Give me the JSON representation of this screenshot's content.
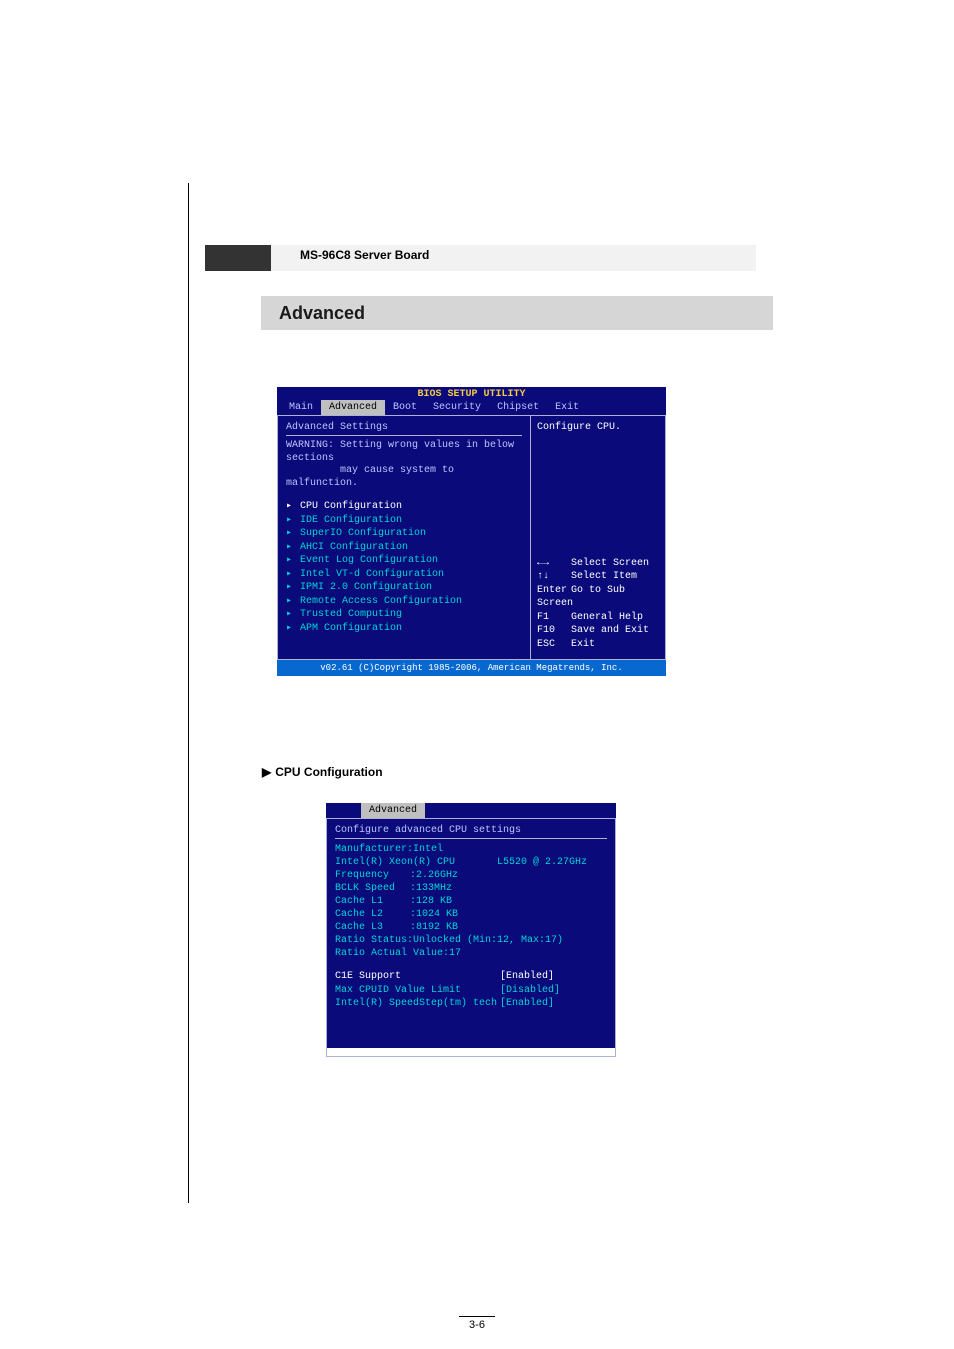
{
  "header": {
    "board_name": "MS-96C8 Server Board"
  },
  "section": {
    "title": "Advanced"
  },
  "bios_main": {
    "title": "BIOS SETUP UTILITY",
    "tabs": [
      "Main",
      "Advanced",
      "Boot",
      "Security",
      "Chipset",
      "Exit"
    ],
    "selected_tab_index": 1,
    "left": {
      "heading": "Advanced Settings",
      "warning_line1": "WARNING: Setting wrong values in below sections",
      "warning_line2": "may cause system to malfunction.",
      "menu": [
        "CPU Configuration",
        "IDE Configuration",
        "SuperIO Configuration",
        "AHCI Configuration",
        "Event Log Configuration",
        "Intel VT-d Configuration",
        "IPMI 2.0 Configuration",
        "Remote Access Configuration",
        "Trusted Computing",
        "APM Configuration"
      ],
      "selected_menu_index": 0
    },
    "right": {
      "help_top": "Configure CPU.",
      "nav": [
        {
          "key": "←→",
          "action": "Select Screen"
        },
        {
          "key": "↑↓",
          "action": "Select Item"
        },
        {
          "key": "Enter",
          "action": "Go to Sub Screen"
        },
        {
          "key": "F1",
          "action": "General Help"
        },
        {
          "key": "F10",
          "action": "Save and Exit"
        },
        {
          "key": "ESC",
          "action": "Exit"
        }
      ]
    },
    "footer": "v02.61 (C)Copyright 1985-2006, American Megatrends, Inc."
  },
  "sub_label": "CPU Configuration",
  "sub_bios": {
    "tabs": [
      "Advanced"
    ],
    "heading": "Configure advanced CPU settings",
    "info": {
      "manufacturer_label": "Manufacturer:Intel",
      "cpu_name": "Intel(R) Xeon(R) CPU",
      "cpu_model": "L5520  @ 2.27GHz",
      "frequency_k": "Frequency",
      "frequency_v": ":2.26GHz",
      "bclk_k": "BCLK Speed",
      "bclk_v": ":133MHz",
      "l1_k": "Cache L1",
      "l1_v": ":128 KB",
      "l2_k": "Cache L2",
      "l2_v": ":1024 KB",
      "l3_k": "Cache L3",
      "l3_v": ":8192 KB",
      "ratio_status": "Ratio Status:Unlocked (Min:12, Max:17)",
      "ratio_actual": "Ratio Actual Value:17"
    },
    "options": [
      {
        "label": "C1E Support",
        "value": "[Enabled]",
        "selected": true
      },
      {
        "label": "Max CPUID Value Limit",
        "value": "[Disabled]",
        "selected": false
      },
      {
        "label": "Intel(R) SpeedStep(tm) tech",
        "value": "[Enabled]",
        "selected": false
      }
    ]
  },
  "page_number": "3-6"
}
